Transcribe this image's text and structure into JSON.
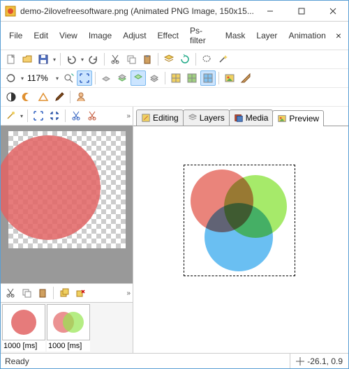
{
  "window": {
    "title": "demo-2ilovefreesoftware.png (Animated PNG Image, 150x15..."
  },
  "menu": {
    "items": [
      "File",
      "Edit",
      "View",
      "Image",
      "Adjust",
      "Effect",
      "Ps-filter",
      "Mask",
      "Layer",
      "Animation"
    ]
  },
  "zoom": {
    "value": "117%"
  },
  "tabs": {
    "editing": "Editing",
    "layers": "Layers",
    "media": "Media",
    "preview": "Preview"
  },
  "frames": [
    {
      "label": "1000 [ms]"
    },
    {
      "label": "1000 [ms]"
    }
  ],
  "status": {
    "ready": "Ready",
    "coords": "-26.1, 0.9"
  }
}
